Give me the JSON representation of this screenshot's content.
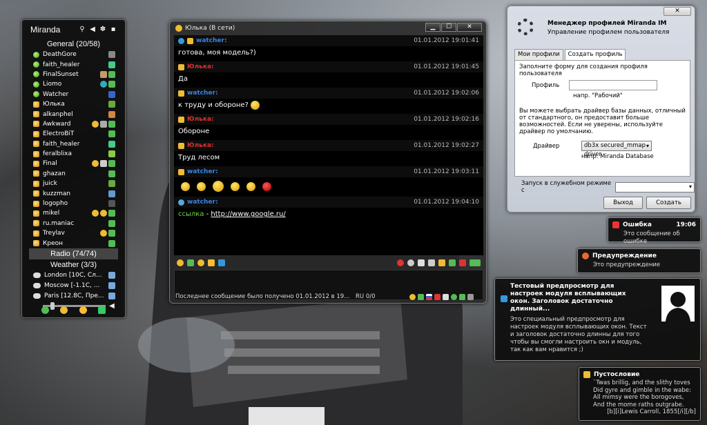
{
  "contact_list": {
    "title": "Miranda",
    "groups": {
      "general": "General (20/58)",
      "radio": "Radio (74/74)",
      "weather": "Weather (3/3)"
    },
    "contacts": [
      {
        "name": "DeathGore",
        "status": "on"
      },
      {
        "name": "faith_healer",
        "status": "on"
      },
      {
        "name": "FinalSunset",
        "status": "on"
      },
      {
        "name": "Liomo",
        "status": "on"
      },
      {
        "name": "Watcher",
        "status": "on"
      },
      {
        "name": "Юлька",
        "status": "away"
      },
      {
        "name": "alkanphel",
        "status": "away"
      },
      {
        "name": "Awkward",
        "status": "away"
      },
      {
        "name": "ElectroBiT",
        "status": "away"
      },
      {
        "name": "faith_healer",
        "status": "away"
      },
      {
        "name": "feralblixa",
        "status": "away"
      },
      {
        "name": "Final",
        "status": "away"
      },
      {
        "name": "ghazan",
        "status": "away"
      },
      {
        "name": "juick",
        "status": "away"
      },
      {
        "name": "kuzzman",
        "status": "away"
      },
      {
        "name": "logopho",
        "status": "away"
      },
      {
        "name": "mikel",
        "status": "away"
      },
      {
        "name": "ru.maniac",
        "status": "away"
      },
      {
        "name": "Treylav",
        "status": "away"
      },
      {
        "name": "Креон",
        "status": "away"
      }
    ],
    "weather": [
      {
        "name": "London [10C, Сл..."
      },
      {
        "name": "Moscow [-1.1C, ..."
      },
      {
        "name": "Paris [12.8C, Пре..."
      }
    ],
    "volume_level": 0.12
  },
  "chat": {
    "title": "Юлька (В сети)",
    "buttons": {
      "minimize": "▁",
      "maximize": "☐",
      "close": "✕"
    },
    "messages": [
      {
        "nick": "watcher:",
        "who": "w",
        "time": "01.01.2012 19:01:41",
        "text": "готова, моя модель?)"
      },
      {
        "nick": "Юлька:",
        "who": "y",
        "time": "01.01.2012 19:01:45",
        "text": "Да"
      },
      {
        "nick": "watcher:",
        "who": "w",
        "time": "01.01.2012 19:02:06",
        "text": "к труду и обороне?"
      },
      {
        "nick": "Юлька:",
        "who": "y",
        "time": "01.01.2012 19:02:16",
        "text": "Обороне"
      },
      {
        "nick": "Юлька:",
        "who": "y",
        "time": "01.01.2012 19:02:27",
        "text": "Труд лесом"
      },
      {
        "nick": "watcher:",
        "who": "w",
        "time": "01.01.2012 19:03:11",
        "text": ""
      },
      {
        "nick": "watcher:",
        "who": "w",
        "time": "01.01.2012 19:04:10",
        "text": ""
      }
    ],
    "link_label": "ссылка",
    "link_sep": " - ",
    "link_url": "http://www.google.ru/",
    "status_text": "Последнее сообщение было получено 01.01.2012 в 19...",
    "status_lang": "RU 0/0"
  },
  "profile_manager": {
    "close": "✕",
    "title": "Менеджер профилей Miranda IM",
    "subtitle": "Управление профилем пользователя",
    "tabs": [
      "Мои профили",
      "Создать профиль"
    ],
    "intro": "Заполните форму для создания профиля пользователя",
    "profile_label": "Профиль",
    "profile_hint": "напр. \"Рабочий\"",
    "driver_note": "Вы можете выбрать драйвер базы данных, отличный от стандартного, он предоставит больше возможностей. Если не уверены, используйте драйвер по умолчанию.",
    "driver_label": "Драйвер",
    "driver_value": "db3x secured_mmap driver",
    "driver_hint": "напр. Miranda Database",
    "service_label": "Запуск в служебном режиме с",
    "exit_button": "Выход",
    "create_button": "Создать"
  },
  "popups": {
    "error": {
      "title": "Ошибка",
      "time": "19:06",
      "text": "Это сообщение об ошибке"
    },
    "warning": {
      "title": "Предупреждение",
      "text": "Это предупреждение"
    },
    "preview": {
      "title": "Тестовый предпросмотр для настроек модуля всплывающих окон. Заголовок достаточно длинный...",
      "text": "Это специальный предпросмотр для настроек модуля всплывающих окон. Текст и заголовок достаточно длинны для того чтобы вы смогли настроить окн и модуль, так как вам нравится ;)"
    },
    "poem": {
      "title": "Пустословие",
      "lines": [
        "`Twas brillig, and the slithy toves",
        "Did gyre and gimble in the wabe:",
        "All mimsy were the borogoves,",
        "And the mome raths outgrabe."
      ],
      "signature": "[b][i]Lewis Carroll, 1855[/i][/b]"
    }
  },
  "colors": {
    "watcher": "#3b83e0",
    "yulka": "#e03030",
    "link_label": "#69d84a"
  }
}
